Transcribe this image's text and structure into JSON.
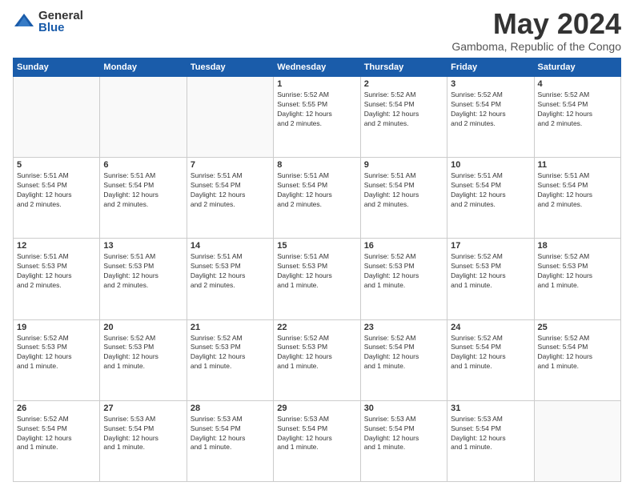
{
  "logo": {
    "general": "General",
    "blue": "Blue"
  },
  "title": "May 2024",
  "location": "Gamboma, Republic of the Congo",
  "weekdays": [
    "Sunday",
    "Monday",
    "Tuesday",
    "Wednesday",
    "Thursday",
    "Friday",
    "Saturday"
  ],
  "weeks": [
    [
      {
        "day": "",
        "detail": ""
      },
      {
        "day": "",
        "detail": ""
      },
      {
        "day": "",
        "detail": ""
      },
      {
        "day": "1",
        "detail": "Sunrise: 5:52 AM\nSunset: 5:55 PM\nDaylight: 12 hours\nand 2 minutes."
      },
      {
        "day": "2",
        "detail": "Sunrise: 5:52 AM\nSunset: 5:54 PM\nDaylight: 12 hours\nand 2 minutes."
      },
      {
        "day": "3",
        "detail": "Sunrise: 5:52 AM\nSunset: 5:54 PM\nDaylight: 12 hours\nand 2 minutes."
      },
      {
        "day": "4",
        "detail": "Sunrise: 5:52 AM\nSunset: 5:54 PM\nDaylight: 12 hours\nand 2 minutes."
      }
    ],
    [
      {
        "day": "5",
        "detail": "Sunrise: 5:51 AM\nSunset: 5:54 PM\nDaylight: 12 hours\nand 2 minutes."
      },
      {
        "day": "6",
        "detail": "Sunrise: 5:51 AM\nSunset: 5:54 PM\nDaylight: 12 hours\nand 2 minutes."
      },
      {
        "day": "7",
        "detail": "Sunrise: 5:51 AM\nSunset: 5:54 PM\nDaylight: 12 hours\nand 2 minutes."
      },
      {
        "day": "8",
        "detail": "Sunrise: 5:51 AM\nSunset: 5:54 PM\nDaylight: 12 hours\nand 2 minutes."
      },
      {
        "day": "9",
        "detail": "Sunrise: 5:51 AM\nSunset: 5:54 PM\nDaylight: 12 hours\nand 2 minutes."
      },
      {
        "day": "10",
        "detail": "Sunrise: 5:51 AM\nSunset: 5:54 PM\nDaylight: 12 hours\nand 2 minutes."
      },
      {
        "day": "11",
        "detail": "Sunrise: 5:51 AM\nSunset: 5:54 PM\nDaylight: 12 hours\nand 2 minutes."
      }
    ],
    [
      {
        "day": "12",
        "detail": "Sunrise: 5:51 AM\nSunset: 5:53 PM\nDaylight: 12 hours\nand 2 minutes."
      },
      {
        "day": "13",
        "detail": "Sunrise: 5:51 AM\nSunset: 5:53 PM\nDaylight: 12 hours\nand 2 minutes."
      },
      {
        "day": "14",
        "detail": "Sunrise: 5:51 AM\nSunset: 5:53 PM\nDaylight: 12 hours\nand 2 minutes."
      },
      {
        "day": "15",
        "detail": "Sunrise: 5:51 AM\nSunset: 5:53 PM\nDaylight: 12 hours\nand 1 minute."
      },
      {
        "day": "16",
        "detail": "Sunrise: 5:52 AM\nSunset: 5:53 PM\nDaylight: 12 hours\nand 1 minute."
      },
      {
        "day": "17",
        "detail": "Sunrise: 5:52 AM\nSunset: 5:53 PM\nDaylight: 12 hours\nand 1 minute."
      },
      {
        "day": "18",
        "detail": "Sunrise: 5:52 AM\nSunset: 5:53 PM\nDaylight: 12 hours\nand 1 minute."
      }
    ],
    [
      {
        "day": "19",
        "detail": "Sunrise: 5:52 AM\nSunset: 5:53 PM\nDaylight: 12 hours\nand 1 minute."
      },
      {
        "day": "20",
        "detail": "Sunrise: 5:52 AM\nSunset: 5:53 PM\nDaylight: 12 hours\nand 1 minute."
      },
      {
        "day": "21",
        "detail": "Sunrise: 5:52 AM\nSunset: 5:53 PM\nDaylight: 12 hours\nand 1 minute."
      },
      {
        "day": "22",
        "detail": "Sunrise: 5:52 AM\nSunset: 5:53 PM\nDaylight: 12 hours\nand 1 minute."
      },
      {
        "day": "23",
        "detail": "Sunrise: 5:52 AM\nSunset: 5:54 PM\nDaylight: 12 hours\nand 1 minute."
      },
      {
        "day": "24",
        "detail": "Sunrise: 5:52 AM\nSunset: 5:54 PM\nDaylight: 12 hours\nand 1 minute."
      },
      {
        "day": "25",
        "detail": "Sunrise: 5:52 AM\nSunset: 5:54 PM\nDaylight: 12 hours\nand 1 minute."
      }
    ],
    [
      {
        "day": "26",
        "detail": "Sunrise: 5:52 AM\nSunset: 5:54 PM\nDaylight: 12 hours\nand 1 minute."
      },
      {
        "day": "27",
        "detail": "Sunrise: 5:53 AM\nSunset: 5:54 PM\nDaylight: 12 hours\nand 1 minute."
      },
      {
        "day": "28",
        "detail": "Sunrise: 5:53 AM\nSunset: 5:54 PM\nDaylight: 12 hours\nand 1 minute."
      },
      {
        "day": "29",
        "detail": "Sunrise: 5:53 AM\nSunset: 5:54 PM\nDaylight: 12 hours\nand 1 minute."
      },
      {
        "day": "30",
        "detail": "Sunrise: 5:53 AM\nSunset: 5:54 PM\nDaylight: 12 hours\nand 1 minute."
      },
      {
        "day": "31",
        "detail": "Sunrise: 5:53 AM\nSunset: 5:54 PM\nDaylight: 12 hours\nand 1 minute."
      },
      {
        "day": "",
        "detail": ""
      }
    ]
  ]
}
